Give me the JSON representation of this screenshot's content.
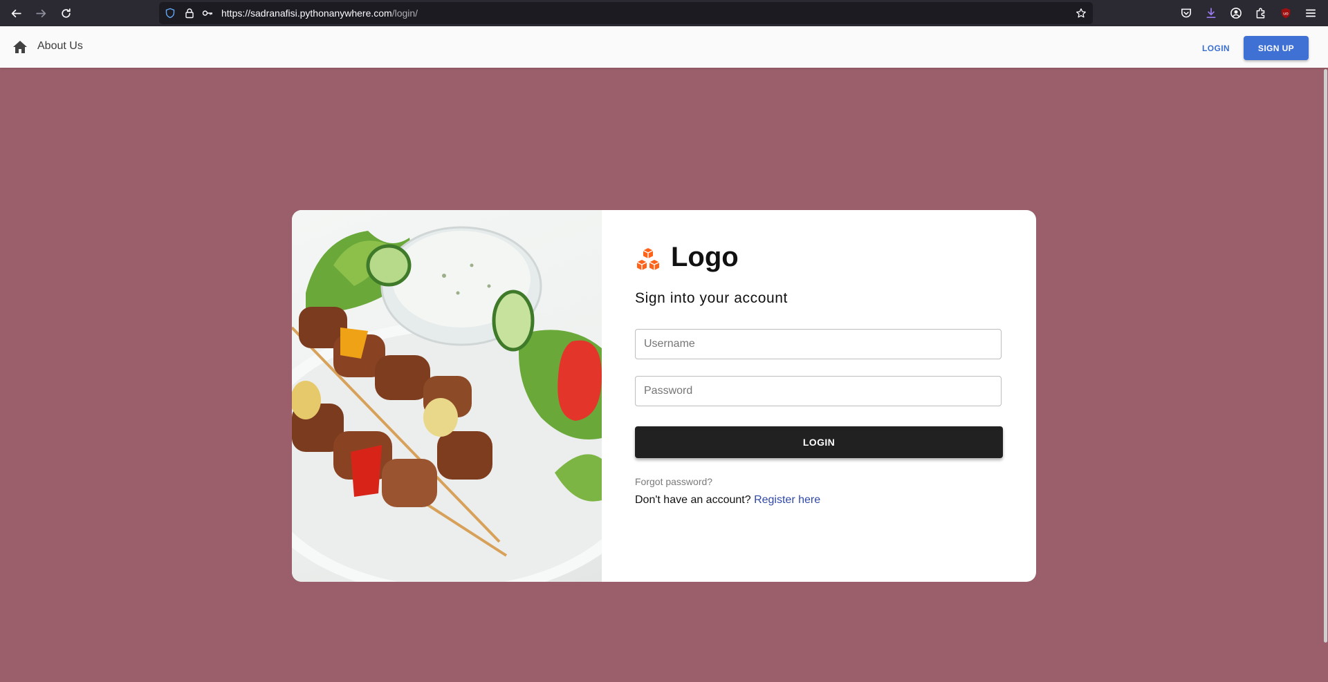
{
  "browser": {
    "url_host": "https://sadranafisi.pythonanywhere.com",
    "url_path": "/login/"
  },
  "header": {
    "about_label": "About Us",
    "login_label": "LOGIN",
    "signup_label": "SIGN UP"
  },
  "card": {
    "logo_text": "Logo",
    "heading": "Sign into your account",
    "username_placeholder": "Username",
    "password_placeholder": "Password",
    "login_button": "LOGIN",
    "forgot_password": "Forgot password?",
    "no_account_text": "Don't have an account?",
    "register_link": "Register here"
  },
  "colors": {
    "page_background": "#9a5f6a",
    "primary_button": "#3f70d3",
    "login_button": "#212121",
    "logo_accent": "#ff6219",
    "link": "#2f47a8"
  },
  "icons": [
    "back-arrow-icon",
    "forward-arrow-icon",
    "reload-icon",
    "shield-icon",
    "lock-icon",
    "key-icon",
    "star-icon",
    "pocket-icon",
    "download-icon",
    "account-icon",
    "extensions-icon",
    "ublock-icon",
    "menu-icon",
    "home-icon",
    "cubes-icon"
  ]
}
